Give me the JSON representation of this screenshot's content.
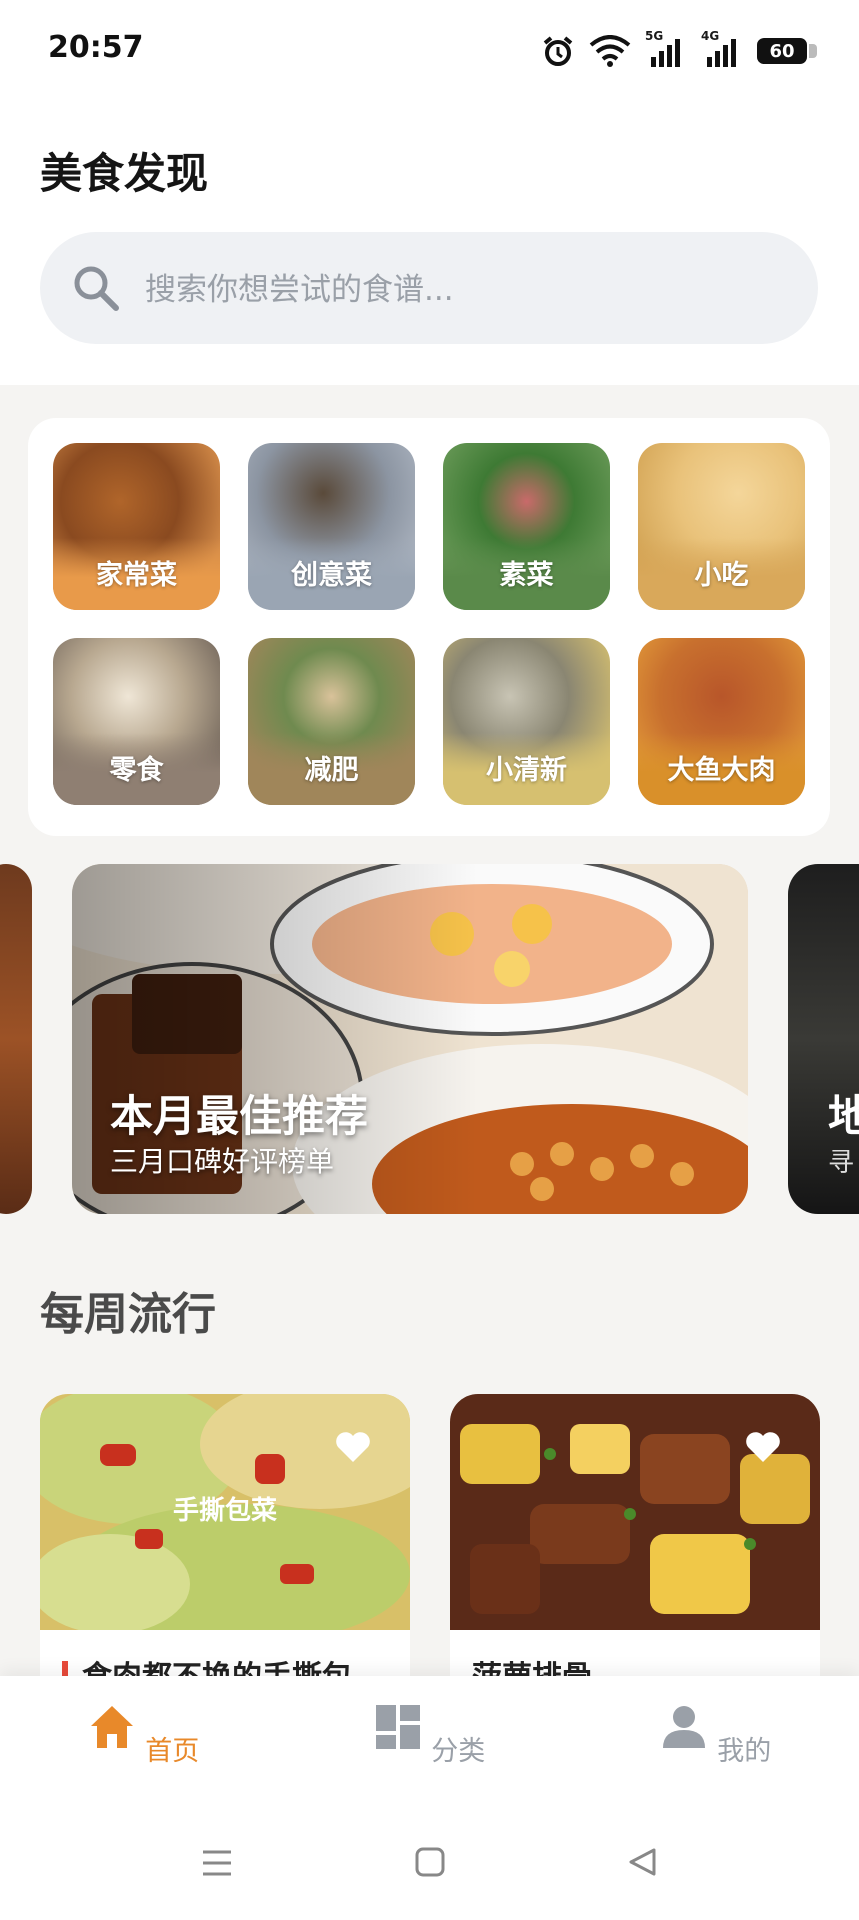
{
  "status_bar": {
    "time": "20:57",
    "network_1": "5G",
    "network_2": "4G",
    "battery": "60"
  },
  "header": {
    "title": "美食发现",
    "search_placeholder": "搜索你想尝试的食谱..."
  },
  "categories": [
    {
      "label": "家常菜",
      "color": "#e89a4a"
    },
    {
      "label": "创意菜",
      "color": "#9aa5b3"
    },
    {
      "label": "素菜",
      "color": "#5a8a4a"
    },
    {
      "label": "小吃",
      "color": "#d9a85a"
    },
    {
      "label": "零食",
      "color": "#8f7f72"
    },
    {
      "label": "减肥",
      "color": "#a0865a"
    },
    {
      "label": "小清新",
      "color": "#d6c070"
    },
    {
      "label": "大鱼大肉",
      "color": "#d9902a"
    }
  ],
  "banner": {
    "title": "本月最佳推荐",
    "subtitle": "三月口碑好评榜单",
    "peek_title": "地",
    "peek_subtitle": "寻"
  },
  "weekly": {
    "title": "每周流行",
    "items": [
      {
        "name": "食肉都不换的手撕包",
        "image_text": "手撕包菜"
      },
      {
        "name": "菠萝排骨"
      }
    ]
  },
  "tabs": [
    {
      "label": "首页",
      "active": true
    },
    {
      "label": "分类",
      "active": false
    },
    {
      "label": "我的",
      "active": false
    }
  ],
  "colors": {
    "accent": "#e8892a",
    "inactive": "#9aa0a8"
  }
}
